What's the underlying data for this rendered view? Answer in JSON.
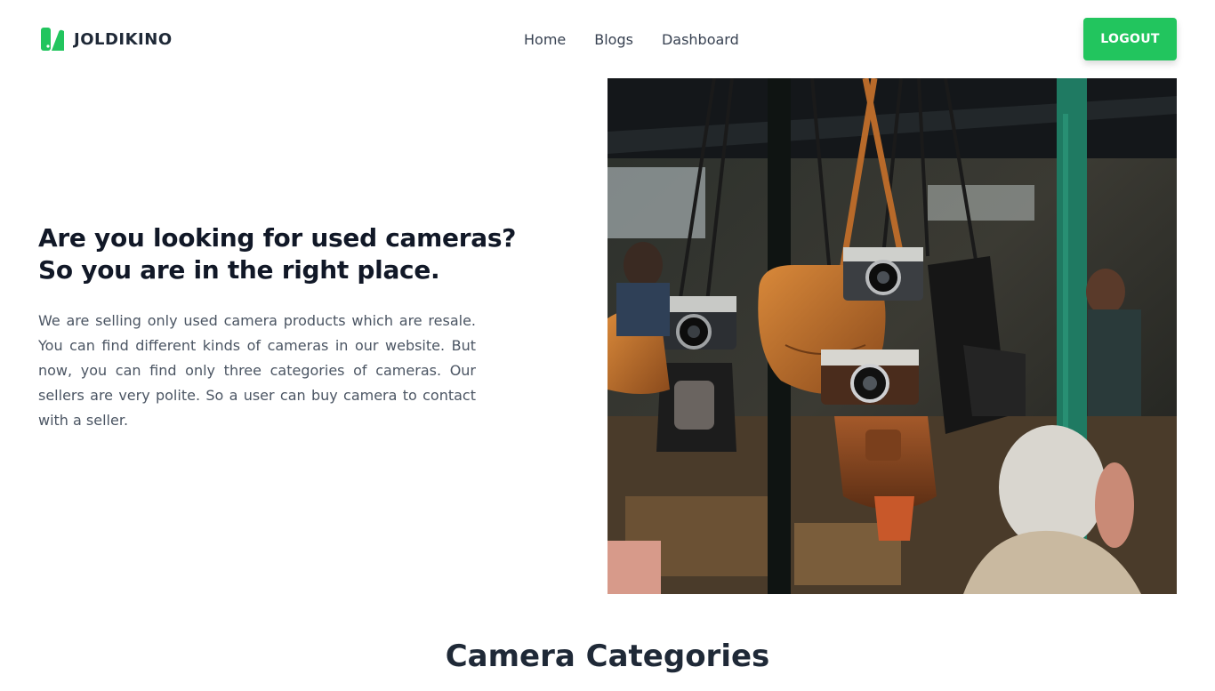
{
  "brand": {
    "name": "JOLDIKINO",
    "logo_icon": "joldikino-logo-icon",
    "accent": "#22c55e"
  },
  "nav": {
    "items": [
      "Home",
      "Blogs",
      "Dashboard"
    ]
  },
  "header": {
    "logout_label": "LOGOUT"
  },
  "hero": {
    "title_line1": "Are you looking for used cameras?",
    "title_line2": "So you are in the right place.",
    "description": "We are selling only used camera products which are resale. You can find different kinds of cameras in our website. But now, you can find only three categories of cameras. Our sellers are very polite. So a user can buy camera to contact with a seller."
  },
  "categories": {
    "title": "Camera Categories"
  }
}
